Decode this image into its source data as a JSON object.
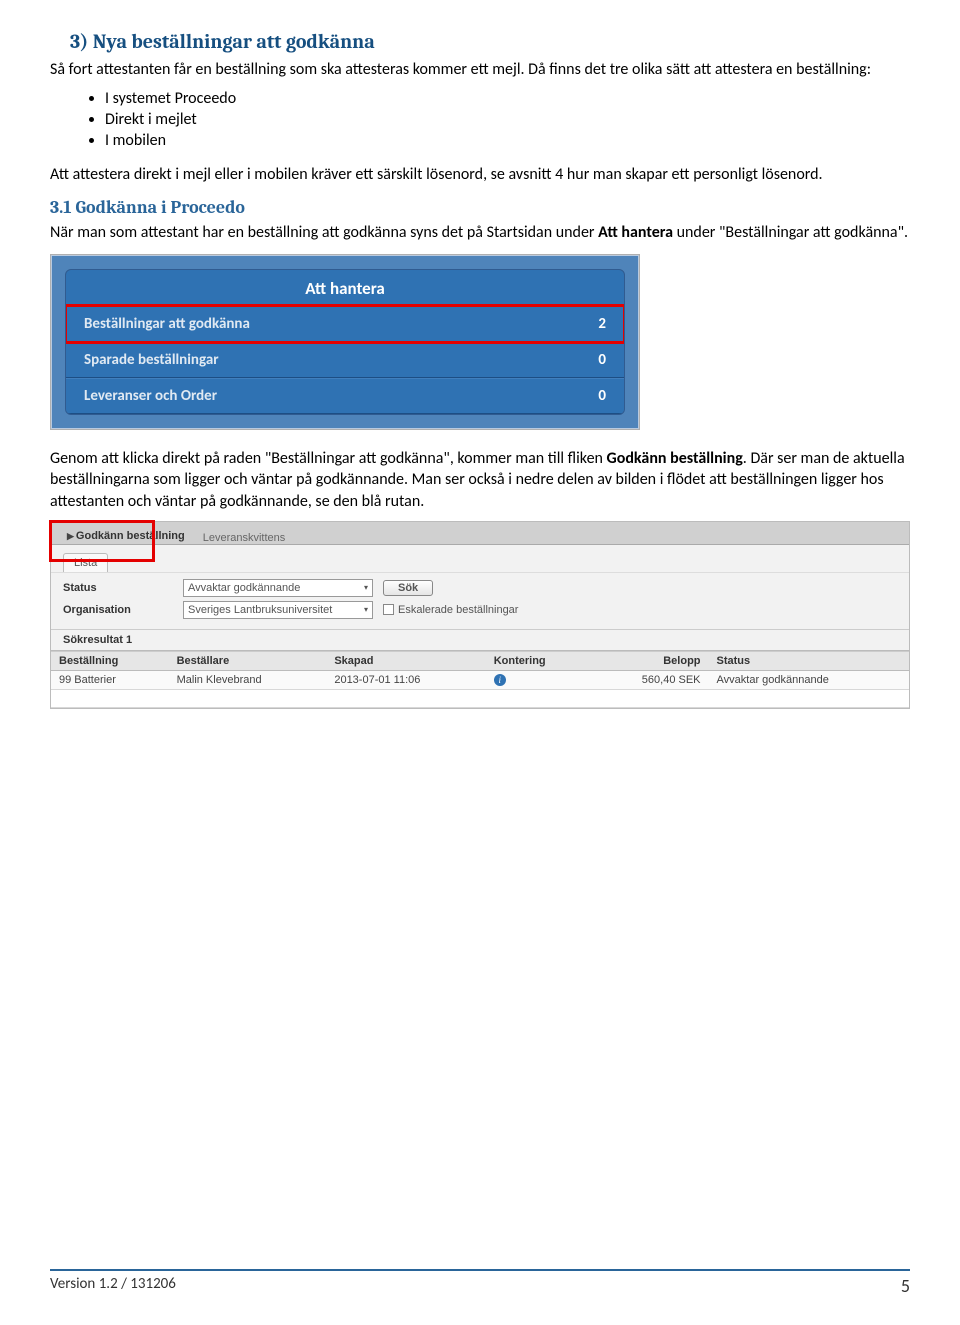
{
  "heading3": "3) Nya beställningar att godkänna",
  "para1": "Så fort attestanten får en beställning som ska attesteras kommer ett mejl. Då finns det tre olika sätt att attestera en beställning:",
  "bullets": [
    "I systemet Proceedo",
    "Direkt i mejlet",
    "I mobilen"
  ],
  "para2": "Att attestera direkt i mejl eller i mobilen kräver ett särskilt lösenord, se avsnitt 4 hur man skapar ett personligt lösenord.",
  "heading31": "3.1 Godkänna i Proceedo",
  "para3a": "När man som attestant har en beställning att godkänna syns det på Startsidan under ",
  "para3b": "Att hantera",
  "para3c": " under \"Beställningar att godkänna\".",
  "panel1": {
    "title": "Att hantera",
    "rows": [
      {
        "label": "Beställningar att godkänna",
        "count": "2"
      },
      {
        "label": "Sparade beställningar",
        "count": "0"
      },
      {
        "label": "Leveranser och Order",
        "count": "0"
      }
    ]
  },
  "para4a": "Genom att klicka direkt på raden \"Beställningar att godkänna\", kommer man till fliken ",
  "para4b": "Godkänn beställning",
  "para4c": ". Där ser man de aktuella beställningarna som ligger och väntar på godkännande. Man ser också i nedre delen av bilden i flödet att beställningen ligger hos attestanten och väntar på godkännande, se den blå rutan.",
  "shot2": {
    "tab1": "Godkänn beställning",
    "tab2": "Leveranskvittens",
    "lista": "Lista",
    "filters": {
      "statusLabel": "Status",
      "statusValue": "Avvaktar godkännande",
      "orgLabel": "Organisation",
      "orgValue": "Sveriges Lantbruksuniversitet",
      "searchBtn": "Sök",
      "escalated": "Eskalerade beställningar"
    },
    "resultLabel": "Sökresultat 1",
    "columns": [
      "Beställning",
      "Beställare",
      "Skapad",
      "Kontering",
      "Belopp",
      "Status"
    ],
    "row": {
      "name": "99 Batterier",
      "user": "Malin Klevebrand",
      "created": "2013-07-01 11:06",
      "amount": "560,40 SEK",
      "status": "Avvaktar godkännande"
    }
  },
  "footer": {
    "version": "Version 1.2  /  131206",
    "page": "5"
  }
}
